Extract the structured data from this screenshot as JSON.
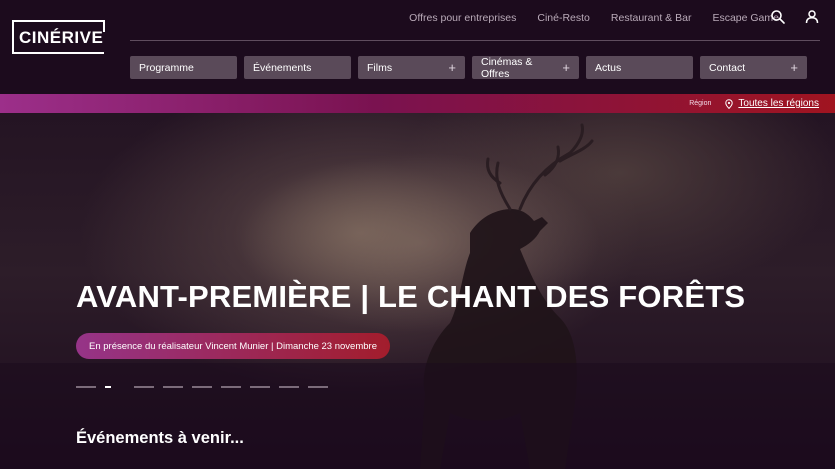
{
  "brand": {
    "logo_text": "CINÉRIVE"
  },
  "top_links": [
    "Offres pour entreprises",
    "Ciné-Resto",
    "Restaurant & Bar",
    "Escape Game"
  ],
  "icons": {
    "search": "search-icon",
    "account": "user-icon"
  },
  "nav": [
    {
      "label": "Programme",
      "has_plus": false
    },
    {
      "label": "Événements",
      "has_plus": false
    },
    {
      "label": "Films",
      "has_plus": true
    },
    {
      "label": "Cinémas & Offres",
      "has_plus": true
    },
    {
      "label": "Actus",
      "has_plus": false
    },
    {
      "label": "Contact",
      "has_plus": true
    }
  ],
  "region": {
    "label": "Région",
    "link": "Toutes les régions"
  },
  "hero": {
    "title": "AVANT-PREMIÈRE | LE CHANT DES FORÊTS",
    "subtitle": "En présence du réalisateur Vincent Munier | Dimanche 23 novembre",
    "slides_total": 9,
    "active_slide": 2
  },
  "sections": {
    "events_title": "Événements à venir..."
  },
  "colors": {
    "background": "#1c0b1d",
    "nav_bg": "#5a4a59",
    "accent_start": "#9c2f8a",
    "accent_end": "#a01420"
  }
}
